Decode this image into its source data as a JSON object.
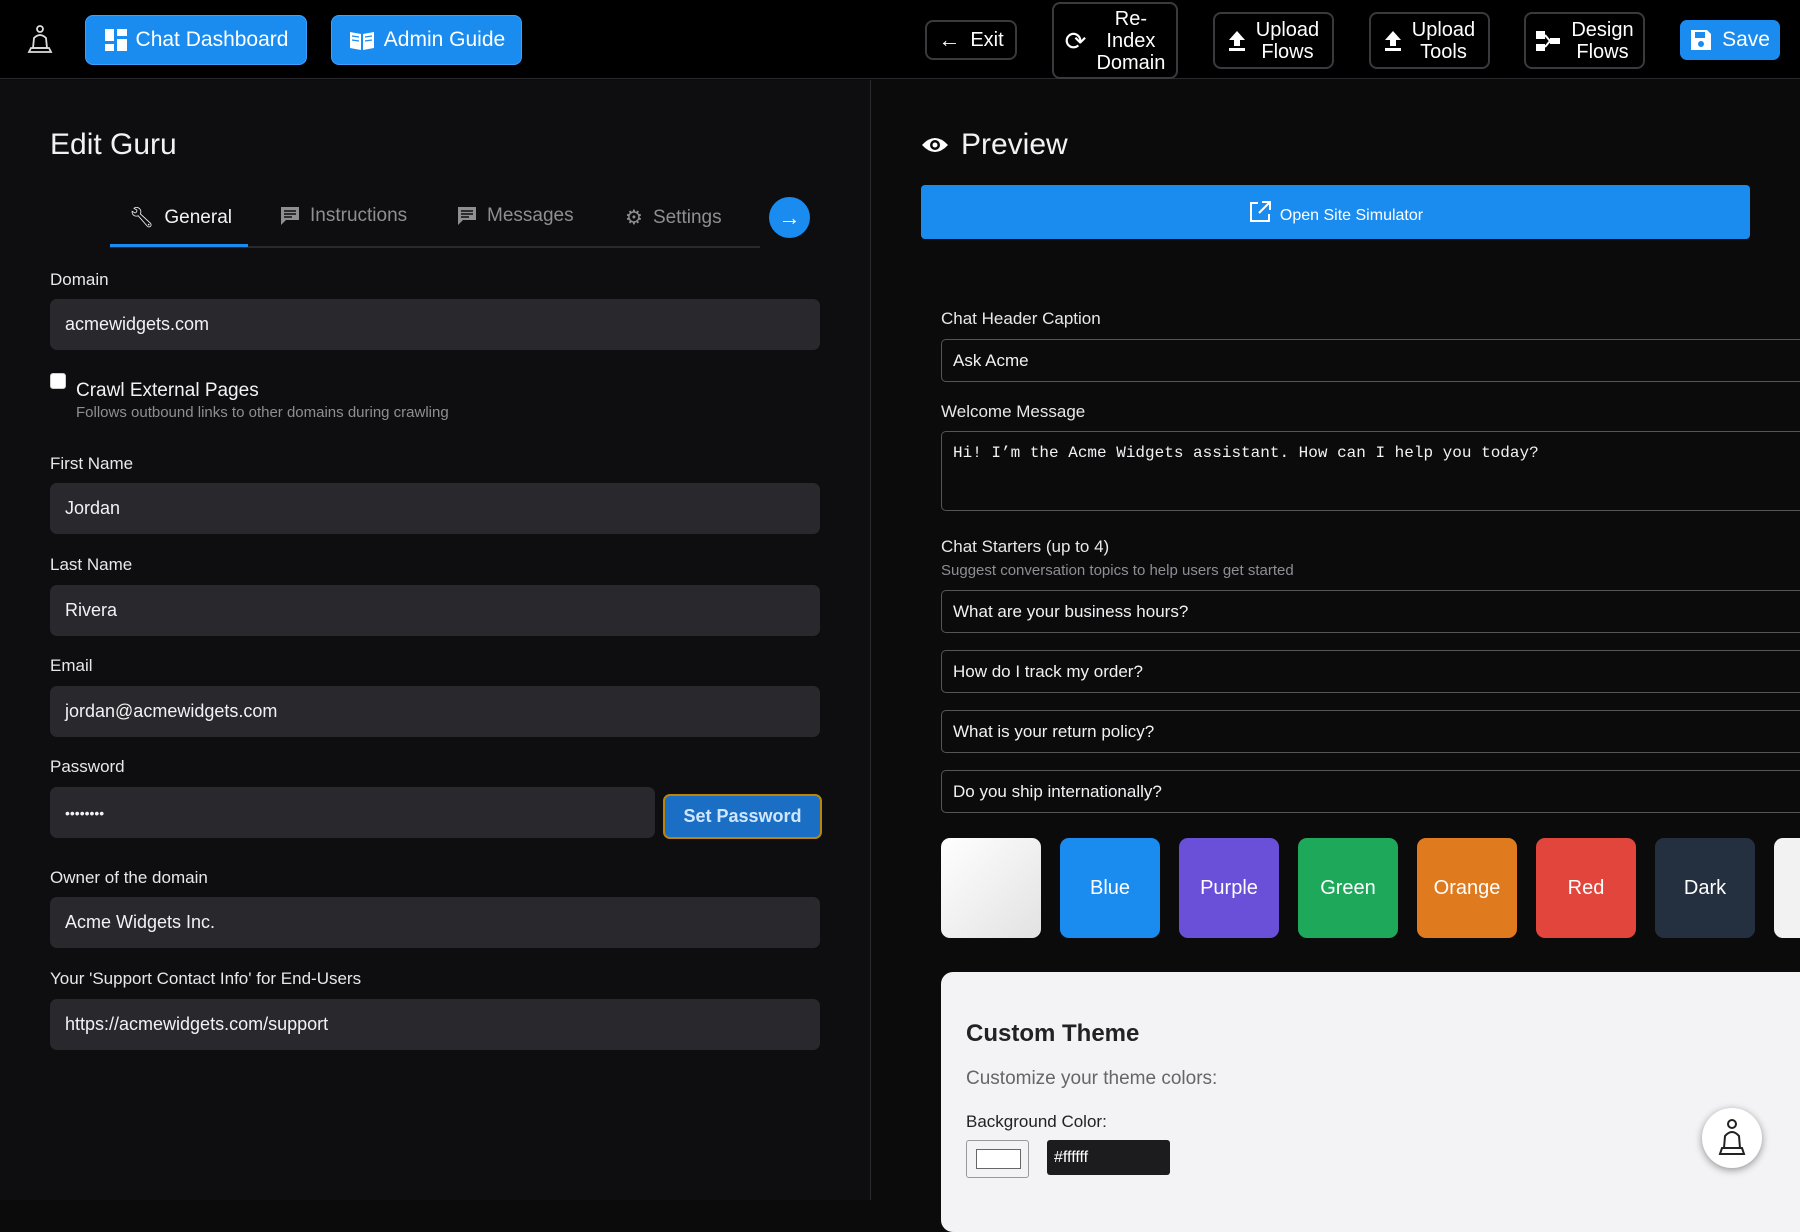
{
  "topbar": {
    "chat_dashboard": "Chat Dashboard",
    "admin_guide": "Admin Guide",
    "exit": "Exit",
    "reindex_line1": "Re-",
    "reindex_line2": "Index",
    "reindex_line3": "Domain",
    "upload_flows_line1": "Upload",
    "upload_flows_line2": "Flows",
    "upload_tools_line1": "Upload",
    "upload_tools_line2": "Tools",
    "design_flows_line1": "Design",
    "design_flows_line2": "Flows",
    "save": "Save"
  },
  "editor": {
    "title": "Edit Guru",
    "tabs": [
      {
        "label": "General",
        "icon": "wrench-icon"
      },
      {
        "label": "Instructions",
        "icon": "message-icon"
      },
      {
        "label": "Messages",
        "icon": "message-icon"
      },
      {
        "label": "Settings",
        "icon": "gear-icon"
      }
    ],
    "domain_label": "Domain",
    "domain_value": "acmewidgets.com",
    "crawl_label": "Crawl External Pages",
    "crawl_help": "Follows outbound links to other domains during crawling",
    "first_name_label": "First Name",
    "first_name_value": "Jordan",
    "last_name_label": "Last Name",
    "last_name_value": "Rivera",
    "email_label": "Email",
    "email_value": "jordan@acmewidgets.com",
    "password_label": "Password",
    "password_value": "••••••••",
    "set_password": "Set Password",
    "owner_label": "Owner of the domain",
    "owner_value": "Acme Widgets Inc.",
    "support_label": "Your 'Support Contact Info' for End-Users",
    "support_value": "https://acmewidgets.com/support"
  },
  "preview": {
    "title": "Preview",
    "simulator_button": "Open Site Simulator",
    "header_caption_label": "Chat Header Caption",
    "header_caption_value": "Ask Acme",
    "welcome_label": "Welcome Message",
    "welcome_value": "Hi! I’m the Acme Widgets assistant. How can I help you today?",
    "starters_label": "Chat Starters (up to 4)",
    "starters_help": "Suggest conversation topics to help users get started",
    "starters": [
      "What are your business hours?",
      "How do I track my order?",
      "What is your return policy?",
      "Do you ship internationally?"
    ],
    "themes": [
      {
        "label": "",
        "color": "#f2f2f2"
      },
      {
        "label": "Blue",
        "color": "#1a8cf0"
      },
      {
        "label": "Purple",
        "color": "#6a4fd8"
      },
      {
        "label": "Green",
        "color": "#1ea85a"
      },
      {
        "label": "Orange",
        "color": "#e07a1f"
      },
      {
        "label": "Red",
        "color": "#e2453c"
      },
      {
        "label": "Dark",
        "color": "#243040"
      }
    ],
    "custom_theme_title": "Custom Theme",
    "custom_theme_sub": "Customize your theme colors:",
    "background_color_label": "Background Color:",
    "background_color_value": "#ffffff"
  }
}
